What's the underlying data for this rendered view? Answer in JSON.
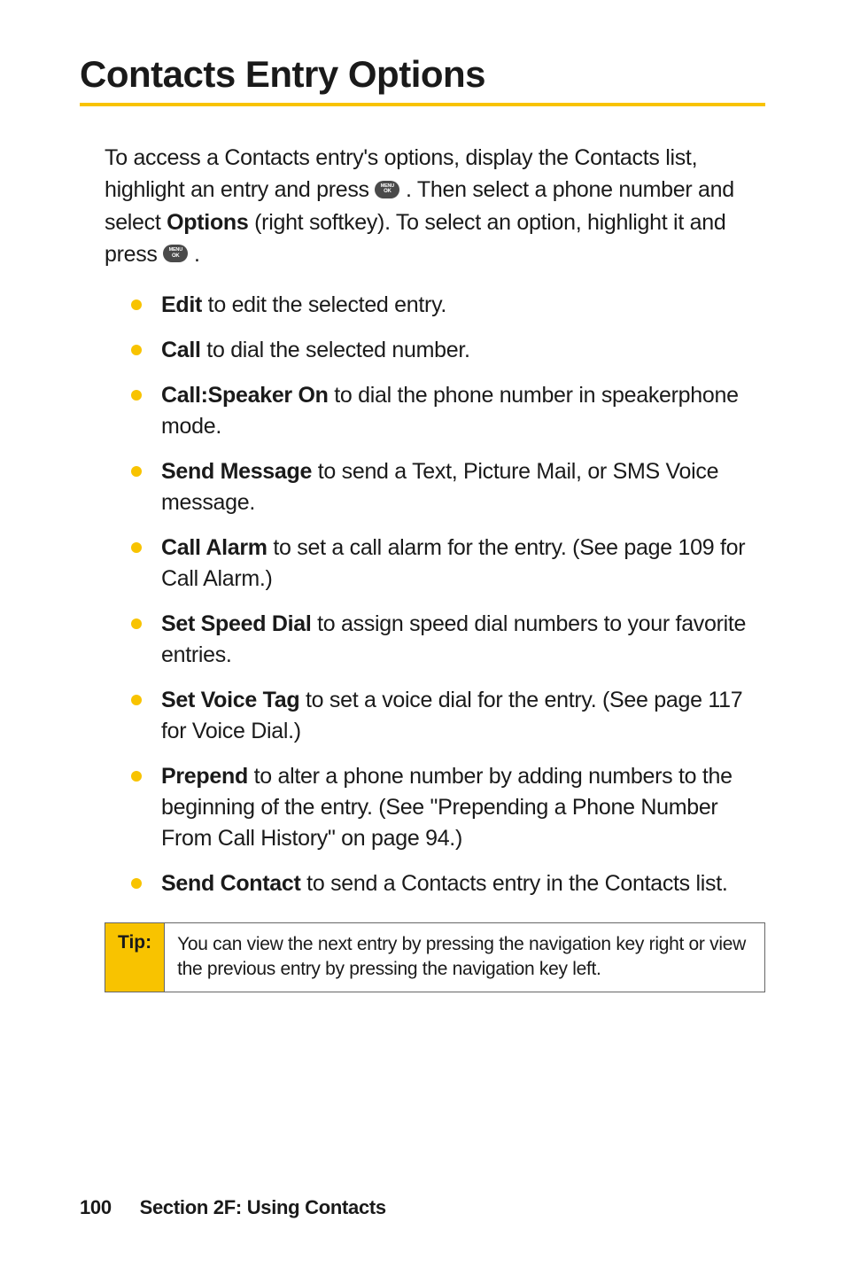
{
  "heading": "Contacts Entry Options",
  "intro": {
    "part1": "To access a Contacts entry's options, display the Contacts list, highlight an entry and press ",
    "part2": ". Then select a phone number and select ",
    "options_bold": "Options",
    "part3": " (right softkey). To select an option, highlight it and press ",
    "part4": "."
  },
  "icon_label_top": "MENU",
  "icon_label_bottom": "OK",
  "bullets": [
    {
      "label": "Edit",
      "text": " to edit the selected entry."
    },
    {
      "label": "Call",
      "text": " to dial the selected number."
    },
    {
      "label": "Call:Speaker On",
      "text": " to dial the phone number in speakerphone mode."
    },
    {
      "label": "Send Message",
      "text": " to send a Text, Picture Mail, or SMS Voice message."
    },
    {
      "label": "Call Alarm",
      "text": " to set a call alarm for the entry. (See page 109 for Call Alarm.)"
    },
    {
      "label": "Set Speed Dial",
      "text": " to assign speed dial numbers to your favorite entries."
    },
    {
      "label": "Set  Voice Tag",
      "text": " to set a voice dial for the entry. (See page 117 for Voice Dial.)"
    },
    {
      "label": "Prepend",
      "text": " to alter a phone number by adding numbers to the beginning of the entry. (See \"Prepending a Phone Number From Call History\" on page 94.)"
    },
    {
      "label": "Send Contact",
      "text": " to send a Contacts entry in the Contacts list."
    }
  ],
  "tip": {
    "label": "Tip:",
    "body": "You can view the next entry by pressing the navigation key right or view the previous entry by pressing the navigation key left."
  },
  "footer": {
    "page": "100",
    "section": "Section 2F: Using Contacts"
  }
}
